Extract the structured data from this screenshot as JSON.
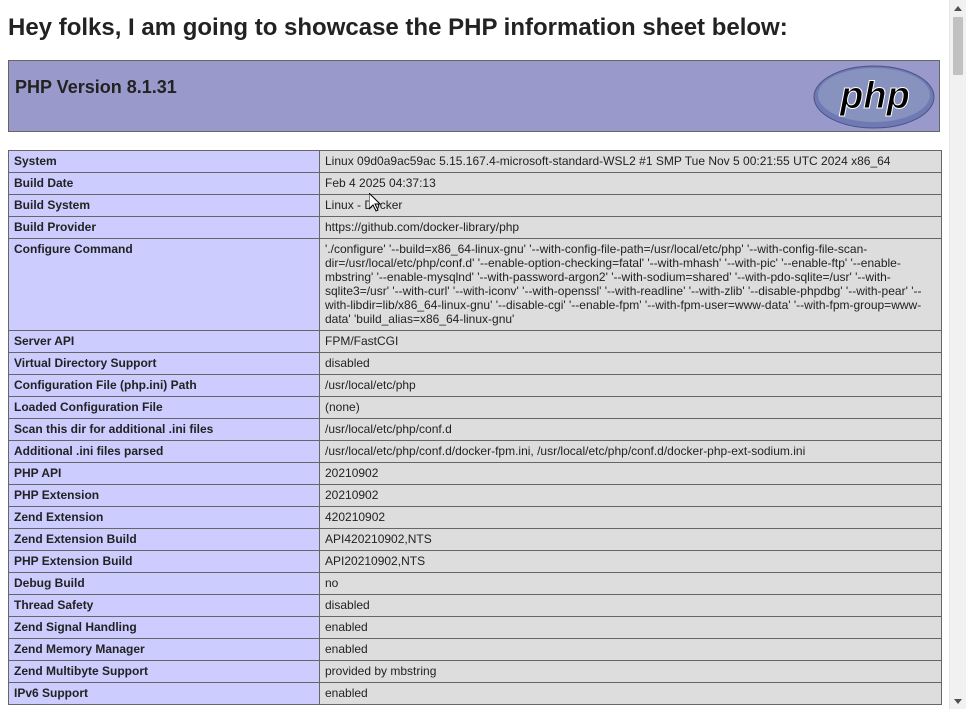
{
  "heading": "Hey folks, I am going to showcase the PHP information sheet below:",
  "php_header": {
    "version_title": "PHP Version 8.1.31",
    "logo_text": "php"
  },
  "rows": [
    {
      "key": "System",
      "value": "Linux 09d0a9ac59ac 5.15.167.4-microsoft-standard-WSL2 #1 SMP Tue Nov 5 00:21:55 UTC 2024 x86_64"
    },
    {
      "key": "Build Date",
      "value": "Feb 4 2025 04:37:13"
    },
    {
      "key": "Build System",
      "value": "Linux - Docker"
    },
    {
      "key": "Build Provider",
      "value": "https://github.com/docker-library/php"
    },
    {
      "key": "Configure Command",
      "value": "'./configure' '--build=x86_64-linux-gnu' '--with-config-file-path=/usr/local/etc/php' '--with-config-file-scan-dir=/usr/local/etc/php/conf.d' '--enable-option-checking=fatal' '--with-mhash' '--with-pic' '--enable-ftp' '--enable-mbstring' '--enable-mysqlnd' '--with-password-argon2' '--with-sodium=shared' '--with-pdo-sqlite=/usr' '--with-sqlite3=/usr' '--with-curl' '--with-iconv' '--with-openssl' '--with-readline' '--with-zlib' '--disable-phpdbg' '--with-pear' '--with-libdir=lib/x86_64-linux-gnu' '--disable-cgi' '--enable-fpm' '--with-fpm-user=www-data' '--with-fpm-group=www-data' 'build_alias=x86_64-linux-gnu'"
    },
    {
      "key": "Server API",
      "value": "FPM/FastCGI"
    },
    {
      "key": "Virtual Directory Support",
      "value": "disabled"
    },
    {
      "key": "Configuration File (php.ini) Path",
      "value": "/usr/local/etc/php"
    },
    {
      "key": "Loaded Configuration File",
      "value": "(none)"
    },
    {
      "key": "Scan this dir for additional .ini files",
      "value": "/usr/local/etc/php/conf.d"
    },
    {
      "key": "Additional .ini files parsed",
      "value": "/usr/local/etc/php/conf.d/docker-fpm.ini, /usr/local/etc/php/conf.d/docker-php-ext-sodium.ini"
    },
    {
      "key": "PHP API",
      "value": "20210902"
    },
    {
      "key": "PHP Extension",
      "value": "20210902"
    },
    {
      "key": "Zend Extension",
      "value": "420210902"
    },
    {
      "key": "Zend Extension Build",
      "value": "API420210902,NTS"
    },
    {
      "key": "PHP Extension Build",
      "value": "API20210902,NTS"
    },
    {
      "key": "Debug Build",
      "value": "no"
    },
    {
      "key": "Thread Safety",
      "value": "disabled"
    },
    {
      "key": "Zend Signal Handling",
      "value": "enabled"
    },
    {
      "key": "Zend Memory Manager",
      "value": "enabled"
    },
    {
      "key": "Zend Multibyte Support",
      "value": "provided by mbstring"
    },
    {
      "key": "IPv6 Support",
      "value": "enabled"
    }
  ],
  "colors": {
    "header_bg": "#9999cc",
    "key_bg": "#ccccff",
    "value_bg": "#dddddd"
  },
  "icons": {
    "logo": "php-logo-icon",
    "scroll_up": "scroll-up-arrow-icon",
    "scroll_down": "scroll-down-arrow-icon",
    "cursor": "mouse-cursor-icon"
  }
}
